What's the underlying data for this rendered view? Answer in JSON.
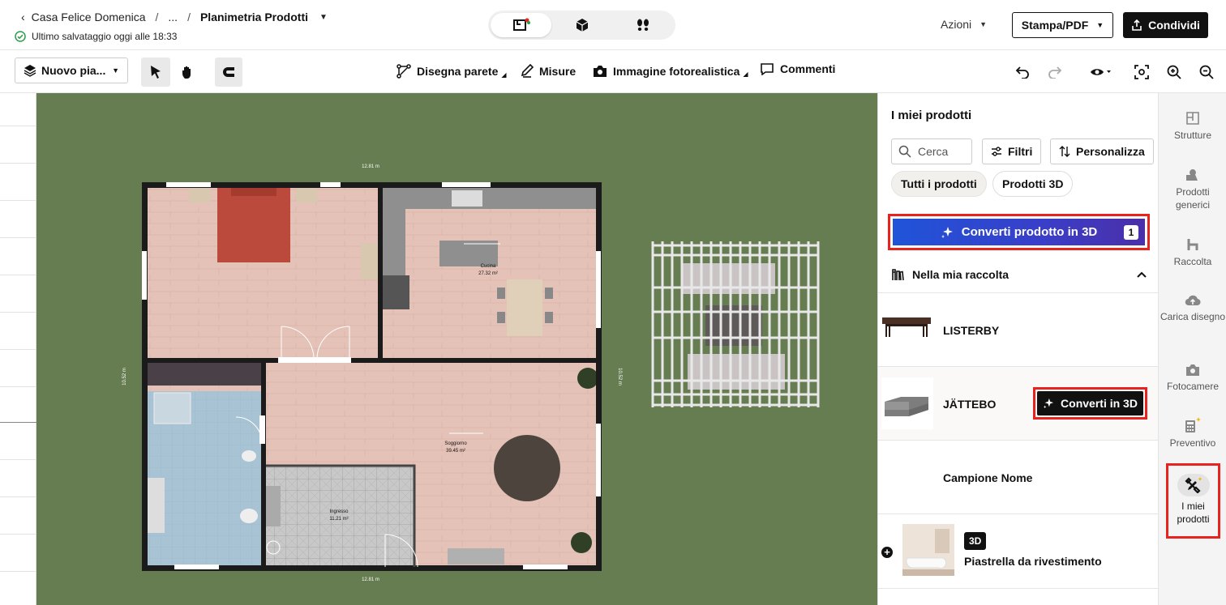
{
  "header": {
    "breadcrumb_project": "Casa Felice Domenica",
    "breadcrumb_sep": "/",
    "breadcrumb_ellipsis": "...",
    "breadcrumb_current": "Planimetria Prodotti",
    "saved_status": "Ultimo salvataggio oggi alle 18:33",
    "actions_label": "Azioni",
    "print_label": "Stampa/PDF",
    "share_label": "Condividi"
  },
  "toolbar": {
    "plan_select": "Nuovo pia...",
    "draw_wall": "Disegna parete",
    "measures": "Misure",
    "photo": "Immagine fotorealistica",
    "comments": "Commenti"
  },
  "floorplan": {
    "dim_top": "12.81 m",
    "dim_bottom": "12.81 m",
    "dim_left": "10.52 m",
    "dim_right": "10.52 m",
    "kitchen_name": "Cucina",
    "kitchen_area": "27.32 m²",
    "living_name": "Soggiorno",
    "living_area": "39.45 m²",
    "entry_name": "Ingresso",
    "entry_area": "11.21 m²"
  },
  "panel": {
    "title": "I miei prodotti",
    "search_placeholder": "Cerca",
    "filters_label": "Filtri",
    "customize_label": "Personalizza",
    "chip_all": "Tutti i prodotti",
    "chip_3d": "Prodotti 3D",
    "convert_main_label": "Converti prodotto in 3D",
    "convert_badge": "1",
    "collection_label": "Nella mia raccolta",
    "products": [
      {
        "name": "LISTERBY"
      },
      {
        "name": "JÄTTEBO",
        "action": "Converti in 3D"
      },
      {
        "name": "Campione Nome"
      },
      {
        "name": "Piastrella da rivestimento",
        "tag": "3D"
      }
    ]
  },
  "rail": {
    "items": [
      {
        "label": "Strutture"
      },
      {
        "label": "Prodotti generici"
      },
      {
        "label": "Raccolta"
      },
      {
        "label": "Carica disegno"
      },
      {
        "label": "Fotocamere"
      },
      {
        "label": "Preventivo"
      },
      {
        "label": "I miei prodotti"
      }
    ]
  },
  "colors": {
    "accent_red": "#e8221e",
    "grass": "#657d50",
    "gradient_start": "#1f54d9",
    "gradient_end": "#4b2fa8"
  }
}
